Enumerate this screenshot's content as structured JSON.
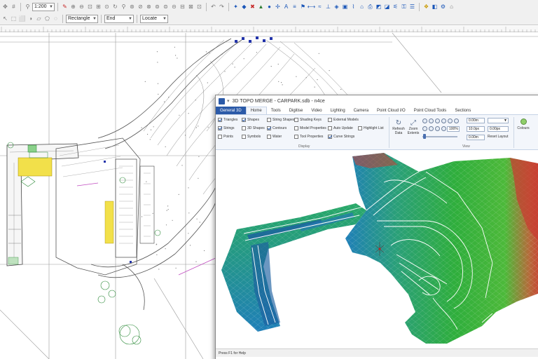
{
  "toolbar": {
    "scale_value": "1:200",
    "select_shape": "Rectangle",
    "end_mode": "End",
    "locate_mode": "Locate",
    "icons": [
      "pan-icon",
      "zoom-in-icon",
      "zoom-out-icon",
      "zoom-window-icon",
      "zoom-extents-icon",
      "redraw-icon",
      "undo-icon",
      "redo-icon",
      "snap-icon",
      "grid-icon",
      "layers-icon",
      "measure-icon",
      "triangle-icon",
      "string-icon",
      "text-icon",
      "properties-icon",
      "settings-icon"
    ]
  },
  "window": {
    "title": "3D TOPO MERGE - CARPARK.sdb - n4ce",
    "tabs": [
      {
        "label": "General 3D"
      },
      {
        "label": "Home"
      },
      {
        "label": "Tools"
      },
      {
        "label": "Digitise"
      },
      {
        "label": "Video"
      },
      {
        "label": "Lighting"
      },
      {
        "label": "Camera"
      },
      {
        "label": "Point Cloud I/O"
      },
      {
        "label": "Point Cloud Tools"
      },
      {
        "label": "Sections"
      }
    ],
    "active_tab": "Home",
    "ribbon": {
      "display_group": "Display",
      "view_group": "View",
      "checks": {
        "triangles": {
          "label": "Triangles",
          "checked": true
        },
        "shapes": {
          "label": "Shapes",
          "checked": true
        },
        "string_shapes": {
          "label": "String Shapes",
          "checked": false
        },
        "shading_keys": {
          "label": "Shading Keys",
          "checked": false
        },
        "external_models": {
          "label": "External Models",
          "checked": false
        },
        "strings": {
          "label": "Strings",
          "checked": true
        },
        "shapes_3d": {
          "label": "3D Shapes",
          "checked": false
        },
        "contours": {
          "label": "Contours",
          "checked": true
        },
        "model_properties": {
          "label": "Model Properties",
          "checked": false
        },
        "auto_update": {
          "label": "Auto Update",
          "checked": false
        },
        "highlight_list": {
          "label": "Highlight List",
          "checked": false
        },
        "points": {
          "label": "Points",
          "checked": false
        },
        "symbols": {
          "label": "Symbols",
          "checked": false
        },
        "water": {
          "label": "Water",
          "checked": false
        },
        "tool_properties": {
          "label": "Tool Properties",
          "checked": false
        },
        "curve_strings": {
          "label": "Curve Strings",
          "checked": true
        }
      },
      "refresh_data": "Refresh Data",
      "zoom_extents": "Zoom Extents",
      "field_1": "0.00m",
      "field_2": "100%",
      "field_3": "10.0px",
      "field_4": "0.00m",
      "field_5": "0.00px",
      "reset_layout": "Reset Layout",
      "colours": "Colours"
    },
    "status_text": "Press F1 for Help"
  },
  "colors": {
    "terrain_high": "#d23030",
    "terrain_mid": "#2fae3c",
    "terrain_low": "#1f7fb8",
    "cad_line": "#6b6b6b",
    "cad_green": "#2e8b3a",
    "cad_yellow": "#f2e04a",
    "cad_blue": "#2233aa"
  }
}
